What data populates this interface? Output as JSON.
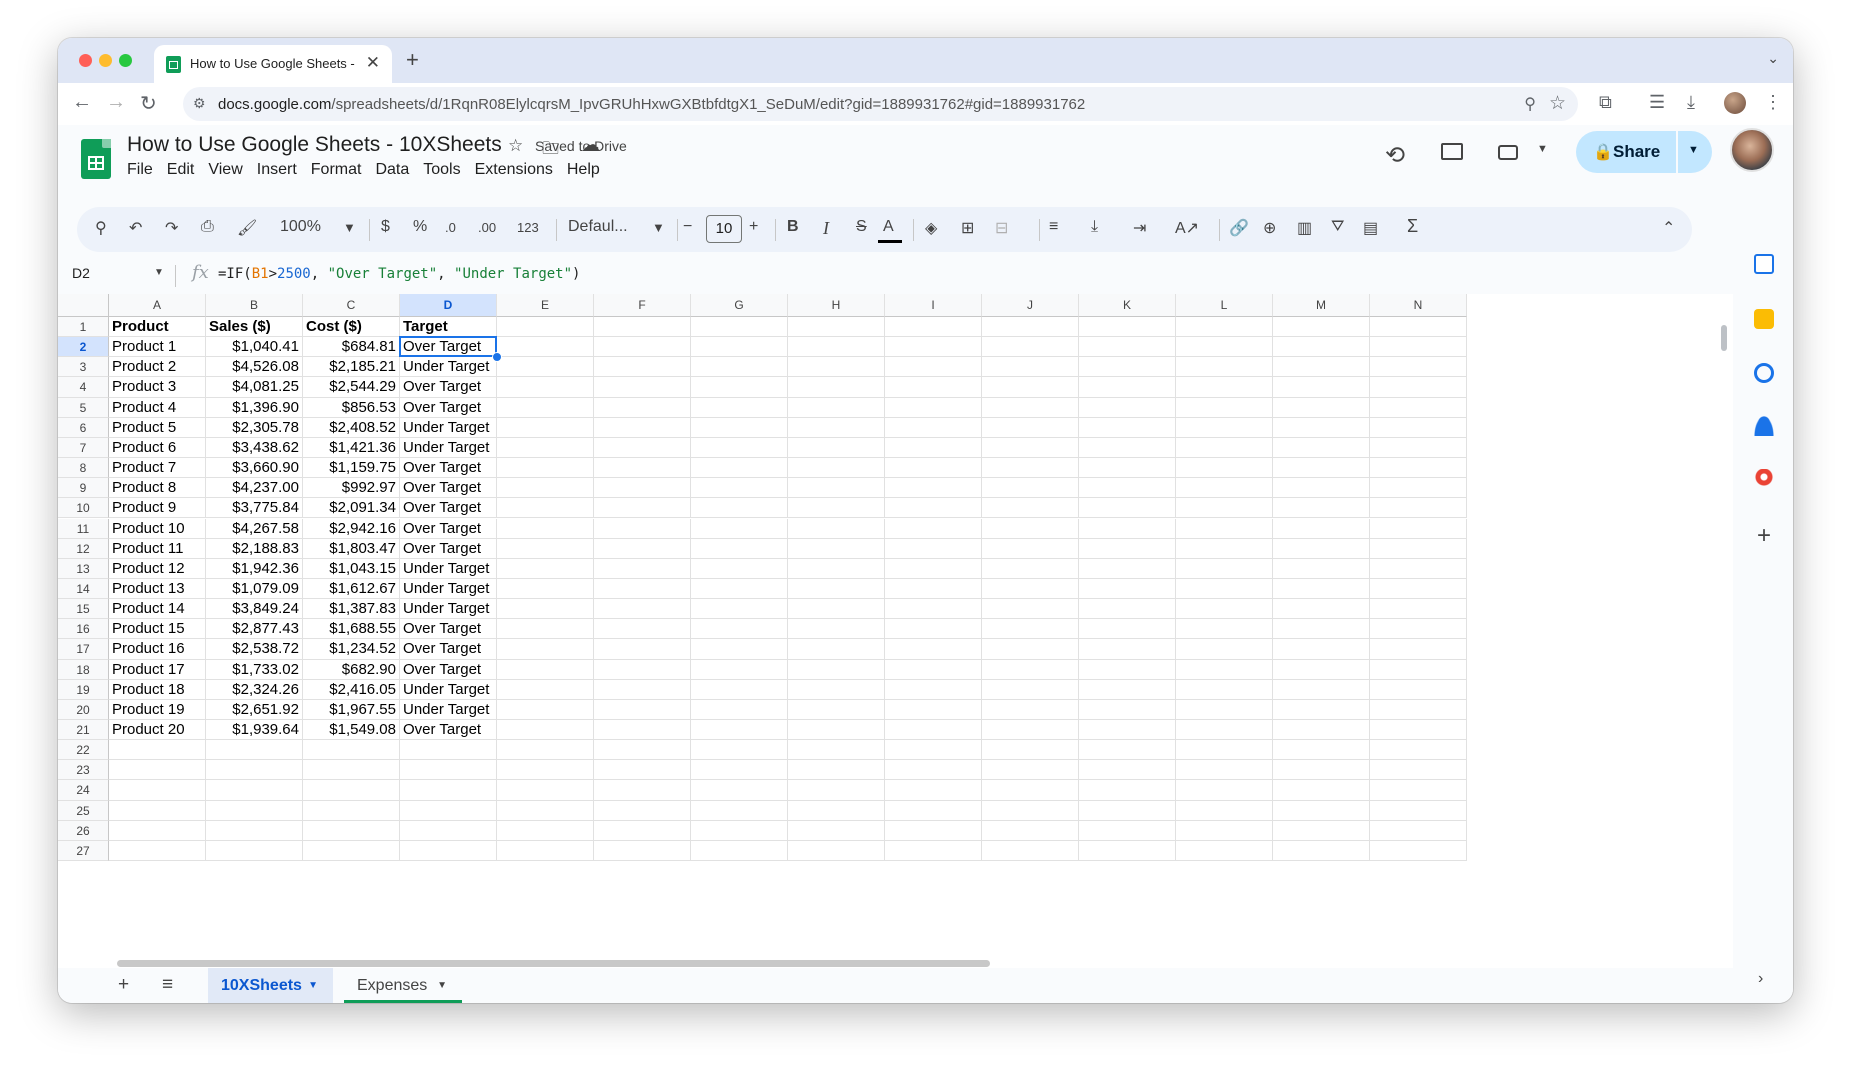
{
  "browser": {
    "tab_title": "How to Use Google Sheets - ",
    "tab_close": "✕",
    "new_tab": "+",
    "url_host": "docs.google.com",
    "url_path": "/spreadsheets/d/1RqnR08ElylcqrsM_IpvGRUhHxwGXBtbfdtgX1_SeDuM/edit?gid=1889931762#gid=1889931762"
  },
  "header": {
    "doc_title": "How to Use Google Sheets - 10XSheets",
    "saved_status": "Saved to Drive",
    "share_label": "Share",
    "menu": [
      "File",
      "Edit",
      "View",
      "Insert",
      "Format",
      "Data",
      "Tools",
      "Extensions",
      "Help"
    ]
  },
  "toolbar": {
    "zoom": "100%",
    "currency": "$",
    "percent": "%",
    "dec_decrease": ".0",
    "dec_increase": ".00",
    "format_123": "123",
    "font": "Defaul...",
    "font_size": "10",
    "bold": "B",
    "italic": "I",
    "strike": "S",
    "text_color": "A",
    "sum": "Σ"
  },
  "formula_bar": {
    "cell_ref": "D2",
    "fx": "fx",
    "formula_prefix": "=IF(",
    "formula_ref": "B1",
    "formula_op": ">",
    "formula_num": "2500",
    "formula_sep1": ", ",
    "formula_str1": "\"Over Target\"",
    "formula_sep2": ", ",
    "formula_str2": "\"Under Target\"",
    "formula_suffix": ")"
  },
  "grid": {
    "columns": [
      "A",
      "B",
      "C",
      "D",
      "E",
      "F",
      "G",
      "H",
      "I",
      "J",
      "K",
      "L",
      "M",
      "N"
    ],
    "selected_column": "D",
    "selected_row": "2",
    "header_row": [
      "Product",
      "Sales ($)",
      "Cost ($)",
      "Target"
    ],
    "rows": [
      [
        "Product 1",
        "$1,040.41",
        "$684.81",
        "Over Target"
      ],
      [
        "Product 2",
        "$4,526.08",
        "$2,185.21",
        "Under Target"
      ],
      [
        "Product 3",
        "$4,081.25",
        "$2,544.29",
        "Over Target"
      ],
      [
        "Product 4",
        "$1,396.90",
        "$856.53",
        "Over Target"
      ],
      [
        "Product 5",
        "$2,305.78",
        "$2,408.52",
        "Under Target"
      ],
      [
        "Product 6",
        "$3,438.62",
        "$1,421.36",
        "Under Target"
      ],
      [
        "Product 7",
        "$3,660.90",
        "$1,159.75",
        "Over Target"
      ],
      [
        "Product 8",
        "$4,237.00",
        "$992.97",
        "Over Target"
      ],
      [
        "Product 9",
        "$3,775.84",
        "$2,091.34",
        "Over Target"
      ],
      [
        "Product 10",
        "$4,267.58",
        "$2,942.16",
        "Over Target"
      ],
      [
        "Product 11",
        "$2,188.83",
        "$1,803.47",
        "Over Target"
      ],
      [
        "Product 12",
        "$1,942.36",
        "$1,043.15",
        "Under Target"
      ],
      [
        "Product 13",
        "$1,079.09",
        "$1,612.67",
        "Under Target"
      ],
      [
        "Product 14",
        "$3,849.24",
        "$1,387.83",
        "Under Target"
      ],
      [
        "Product 15",
        "$2,877.43",
        "$1,688.55",
        "Over Target"
      ],
      [
        "Product 16",
        "$2,538.72",
        "$1,234.52",
        "Over Target"
      ],
      [
        "Product 17",
        "$1,733.02",
        "$682.90",
        "Over Target"
      ],
      [
        "Product 18",
        "$2,324.26",
        "$2,416.05",
        "Under Target"
      ],
      [
        "Product 19",
        "$2,651.92",
        "$1,967.55",
        "Under Target"
      ],
      [
        "Product 20",
        "$1,939.64",
        "$1,549.08",
        "Over Target"
      ]
    ],
    "row_numbers": [
      "1",
      "2",
      "3",
      "4",
      "5",
      "6",
      "7",
      "8",
      "9",
      "10",
      "11",
      "12",
      "13",
      "14",
      "15",
      "16",
      "17",
      "18",
      "19",
      "20",
      "21",
      "22",
      "23",
      "24",
      "25",
      "26",
      "27"
    ]
  },
  "sheets": {
    "add": "+",
    "all_sheets": "≡",
    "tabs": [
      {
        "label": "10XSheets",
        "active": true,
        "color": "#0b57d0"
      },
      {
        "label": "Expenses",
        "active": false,
        "color": "#0f9d58"
      }
    ]
  },
  "colors": {
    "accent": "#1a73e8",
    "share_bg": "#c2e7ff",
    "sheets_green": "#0f9d58"
  }
}
